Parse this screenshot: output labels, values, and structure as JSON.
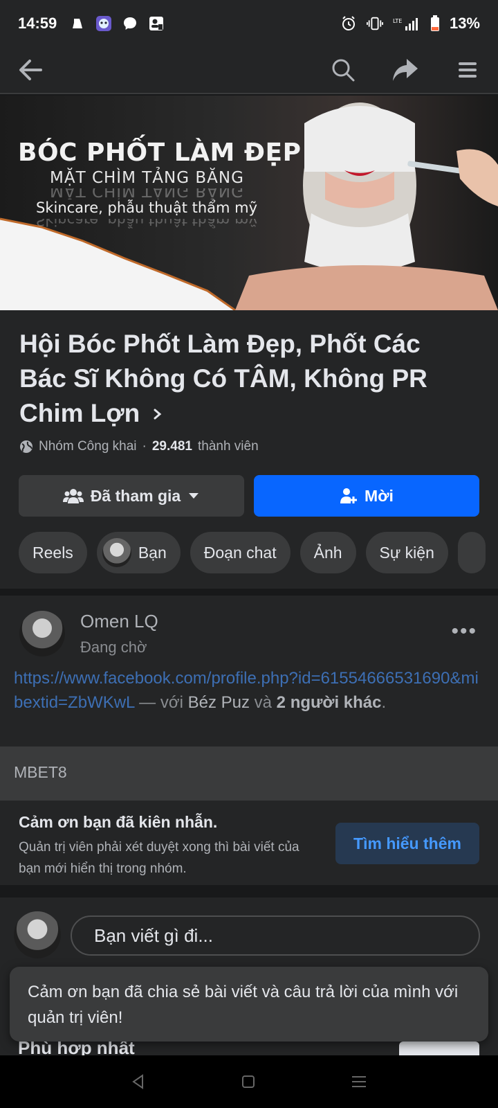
{
  "status_bar": {
    "time": "14:59",
    "network": "LTE",
    "battery": "13%"
  },
  "cover": {
    "title": "BÓC PHỐT LÀM ĐẸP",
    "subtitle": "MẶT CHÌM TẢNG BĂNG",
    "tagline": "Skincare, phẫu thuật thẩm mỹ"
  },
  "group": {
    "name": "Hội Bóc Phốt Làm Đẹp, Phốt Các Bác Sĩ Không Có TÂM, Không PR Chim Lợn",
    "privacy": "Nhóm Công khai",
    "separator": "·",
    "member_count": "29.481",
    "member_label": "thành viên",
    "joined_button": "Đã tham gia",
    "invite_button": "Mời",
    "tabs": [
      "Reels",
      "Bạn",
      "Đoạn chat",
      "Ảnh",
      "Sự kiện"
    ]
  },
  "post": {
    "author": "Omen LQ",
    "status": "Đang chờ",
    "link": "https://www.facebook.com/profile.php?id=61554666531690&mibextid=ZbWKwL",
    "with_text": " — với ",
    "tagged_name": "Béz Puz",
    "and_text": " và ",
    "others": "2 người khác",
    "end": "."
  },
  "sponsor_label": "MBET8",
  "notice": {
    "title": "Cảm ơn bạn đã kiên nhẫn.",
    "text": "Quản trị viên phải xét duyệt xong thì bài viết của bạn mới hiển thị trong nhóm.",
    "button": "Tìm hiểu thêm"
  },
  "composer": {
    "placeholder": "Bạn viết gì đi..."
  },
  "below_section": {
    "title": "Phù hợp nhất"
  },
  "toast": {
    "message": "Cảm ơn bạn đã chia sẻ bài viết và câu trả lời của mình với quản trị viên!"
  }
}
